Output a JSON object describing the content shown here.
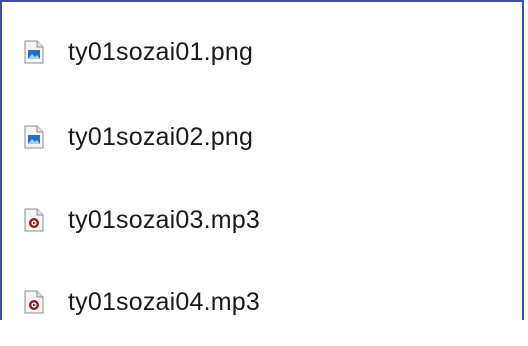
{
  "files": [
    {
      "name": "ty01sozai01.png",
      "icon": "image-file-icon"
    },
    {
      "name": "ty01sozai02.png",
      "icon": "image-file-icon"
    },
    {
      "name": "ty01sozai03.mp3",
      "icon": "audio-file-icon"
    },
    {
      "name": "ty01sozai04.mp3",
      "icon": "audio-file-icon"
    }
  ],
  "colors": {
    "frame_border": "#3c4fa6",
    "text": "#1a1a1a",
    "image_icon_accent": "#2b6cc4",
    "audio_icon_accent": "#8a1c1c"
  }
}
